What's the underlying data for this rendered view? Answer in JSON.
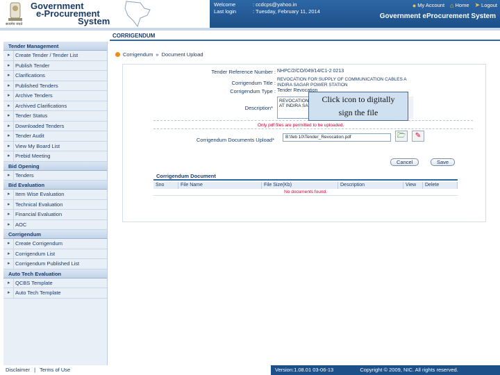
{
  "brand": {
    "line1": "Government",
    "line2": "e-Procurement",
    "line3": "System",
    "hindi": "सत्यमेव जयते"
  },
  "topbar": {
    "welcome_label": "Welcome",
    "welcome_value": ": ccdcps@yahoo.in",
    "last_login_label": "Last login",
    "last_login_value": ": Tuesday, February 11, 2014",
    "my_account": "My Account",
    "home": "Home",
    "logout": "Logout",
    "system_title": "Government eProcurement System"
  },
  "page_title": "CORRIGENDUM",
  "breadcrumb": {
    "current": "Corrigendum",
    "separator": "»",
    "page": "Document Upload"
  },
  "sidebar": {
    "sections": [
      {
        "title": "Tender Management",
        "items": [
          "Create Tender / Tender List",
          "Publish Tender",
          "Clarifications",
          "Published Tenders",
          "Archive Tenders",
          "Archived Clarifications",
          "Tender Status",
          "Downloaded Tenders",
          "Tender Audit",
          "View My Board List",
          "Prebid Meeting"
        ]
      },
      {
        "title": "Bid Opening",
        "items": [
          "Tenders"
        ]
      },
      {
        "title": "Bid Evaluation",
        "items": [
          "Item Wise Evaluation",
          "Technical Evaluation",
          "Financial Evaluation",
          "AOC"
        ]
      },
      {
        "title": "Corrigendum",
        "items": [
          "Create Corrigendum",
          "Corrigendum List",
          "Corrigendum Published List"
        ]
      },
      {
        "title": "Auto Tech Evaluation",
        "items": [
          "QCBS Template",
          "Auto Tech Template"
        ]
      }
    ]
  },
  "form": {
    "tender_ref_label": "Tender Reference Number :",
    "tender_ref_value": "NHPC/2/CO/049/14/C1-2 0213",
    "title_label": "Corrigendum Title :",
    "title_value": "REVOCATION FOR SUPPLY OF COMMUNICATION CABLES A INDIRA SAGAR POWER STATION",
    "type_label": "Corrigendum Type :",
    "type_value": "Tender Revocation",
    "description_label": "Description*",
    "description_value": "REVOCATION FOR SUPPLY OF COMMUNICATION CABLES AT INDIRA SAGAR POWER STATION",
    "note": "Only pdf files are permitted to be uploaded.",
    "upload_label": "Corrigendum Documents Upload*",
    "file_path": "B:\\feb 10\\Tender_Revocation.pdf",
    "cancel_label": "Cancel",
    "save_label": "Save"
  },
  "documents": {
    "title": "Corrigendum Document",
    "columns": [
      "Sno",
      "File Name",
      "File Size(Kb)",
      "Description",
      "View",
      "Delete"
    ],
    "empty_text": "No documents found."
  },
  "tooltip": {
    "line1": "Click icon to digitally",
    "line2": "sign the file"
  },
  "footer": {
    "disclaimer": "Disclaimer",
    "separator": "|",
    "terms": "Terms of Use",
    "version": "Version:1.08.01 03-06-13",
    "copyright": "Copyright © 2009, NIC. All rights reserved."
  },
  "icons": {
    "upload": "folder-up-icon",
    "sign": "digital-sign-icon",
    "home": "home-icon",
    "account": "user-icon",
    "logout": "logout-icon"
  }
}
